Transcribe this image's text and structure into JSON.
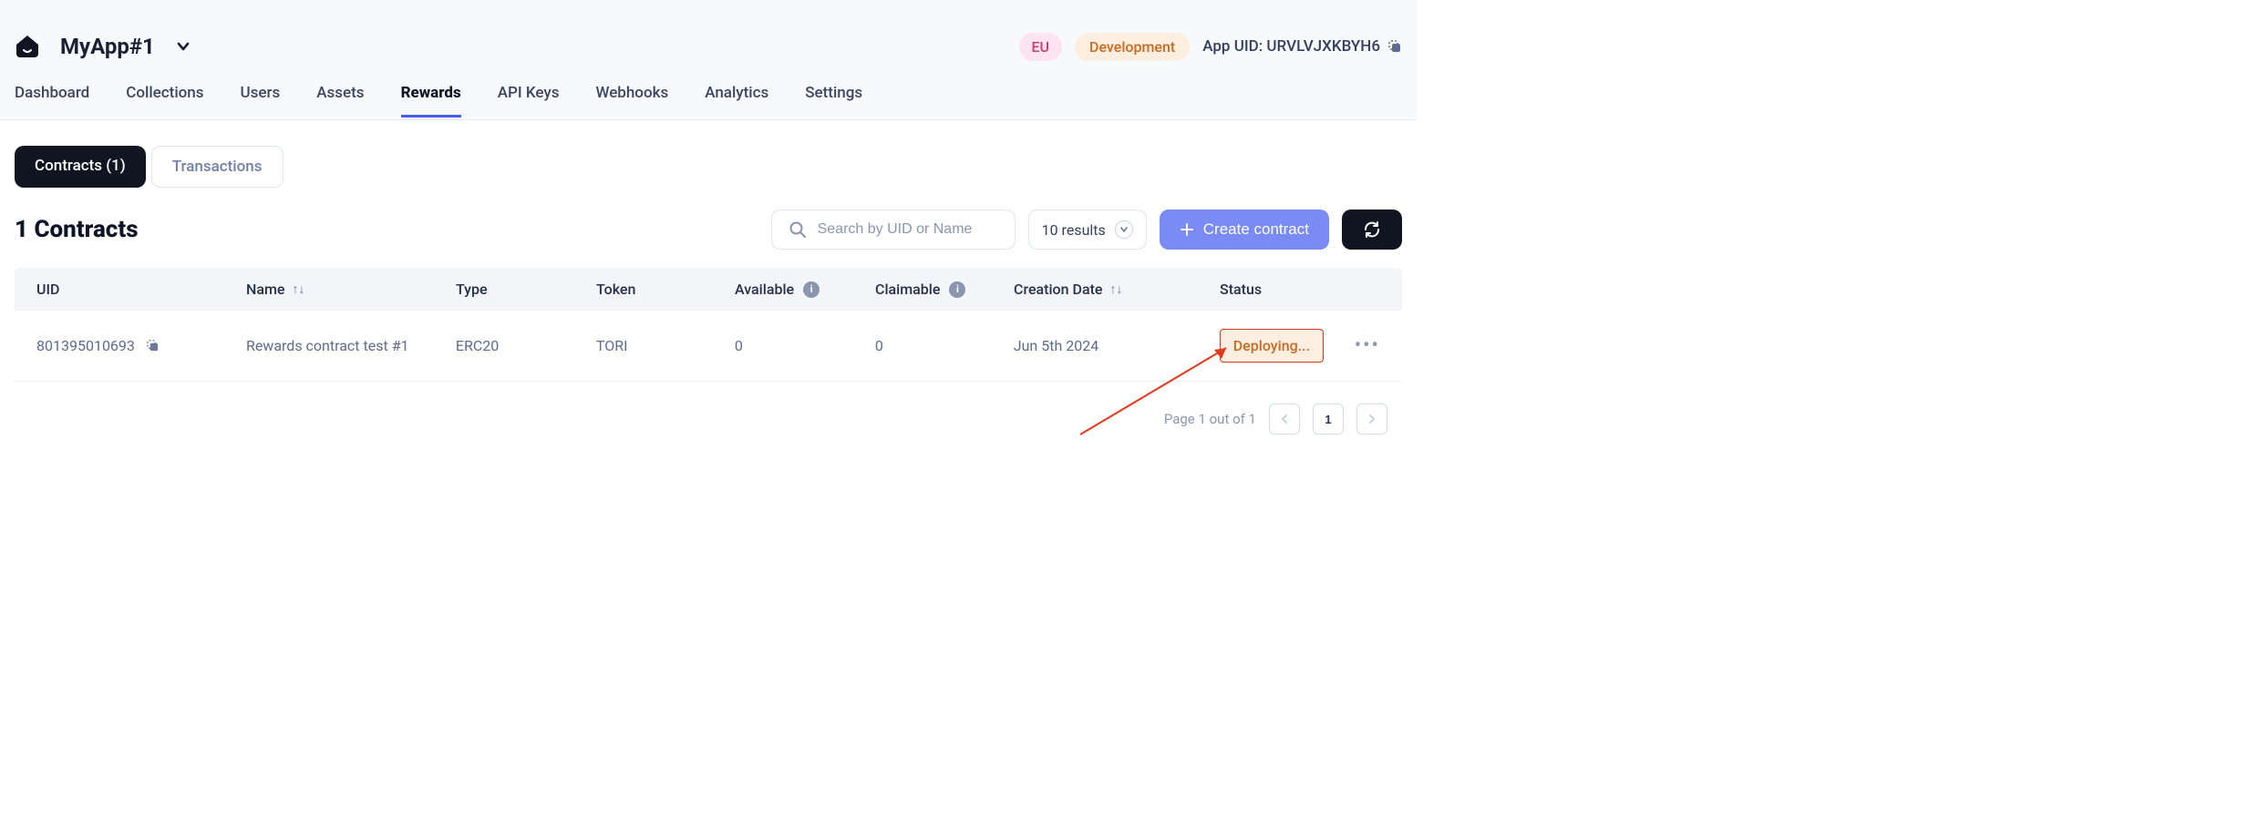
{
  "header": {
    "app_name": "MyApp#1",
    "region_badge": "EU",
    "env_badge": "Development",
    "app_uid_label": "App UID: URVLVJXKBYH6"
  },
  "nav": {
    "items": [
      "Dashboard",
      "Collections",
      "Users",
      "Assets",
      "Rewards",
      "API Keys",
      "Webhooks",
      "Analytics",
      "Settings"
    ],
    "active_index": 4
  },
  "subtabs": {
    "contracts": "Contracts (1)",
    "transactions": "Transactions"
  },
  "page": {
    "title": "1 Contracts",
    "search_placeholder": "Search by UID or Name",
    "results_label": "10 results",
    "create_label": "Create contract"
  },
  "table": {
    "headers": {
      "uid": "UID",
      "name": "Name",
      "type": "Type",
      "token": "Token",
      "available": "Available",
      "claimable": "Claimable",
      "date": "Creation Date",
      "status": "Status"
    },
    "rows": [
      {
        "uid": "801395010693",
        "name": "Rewards contract test #1",
        "type": "ERC20",
        "token": "TORI",
        "available": "0",
        "claimable": "0",
        "date": "Jun 5th 2024",
        "status": "Deploying..."
      }
    ]
  },
  "pagination": {
    "summary": "Page 1 out of 1",
    "current": "1"
  }
}
